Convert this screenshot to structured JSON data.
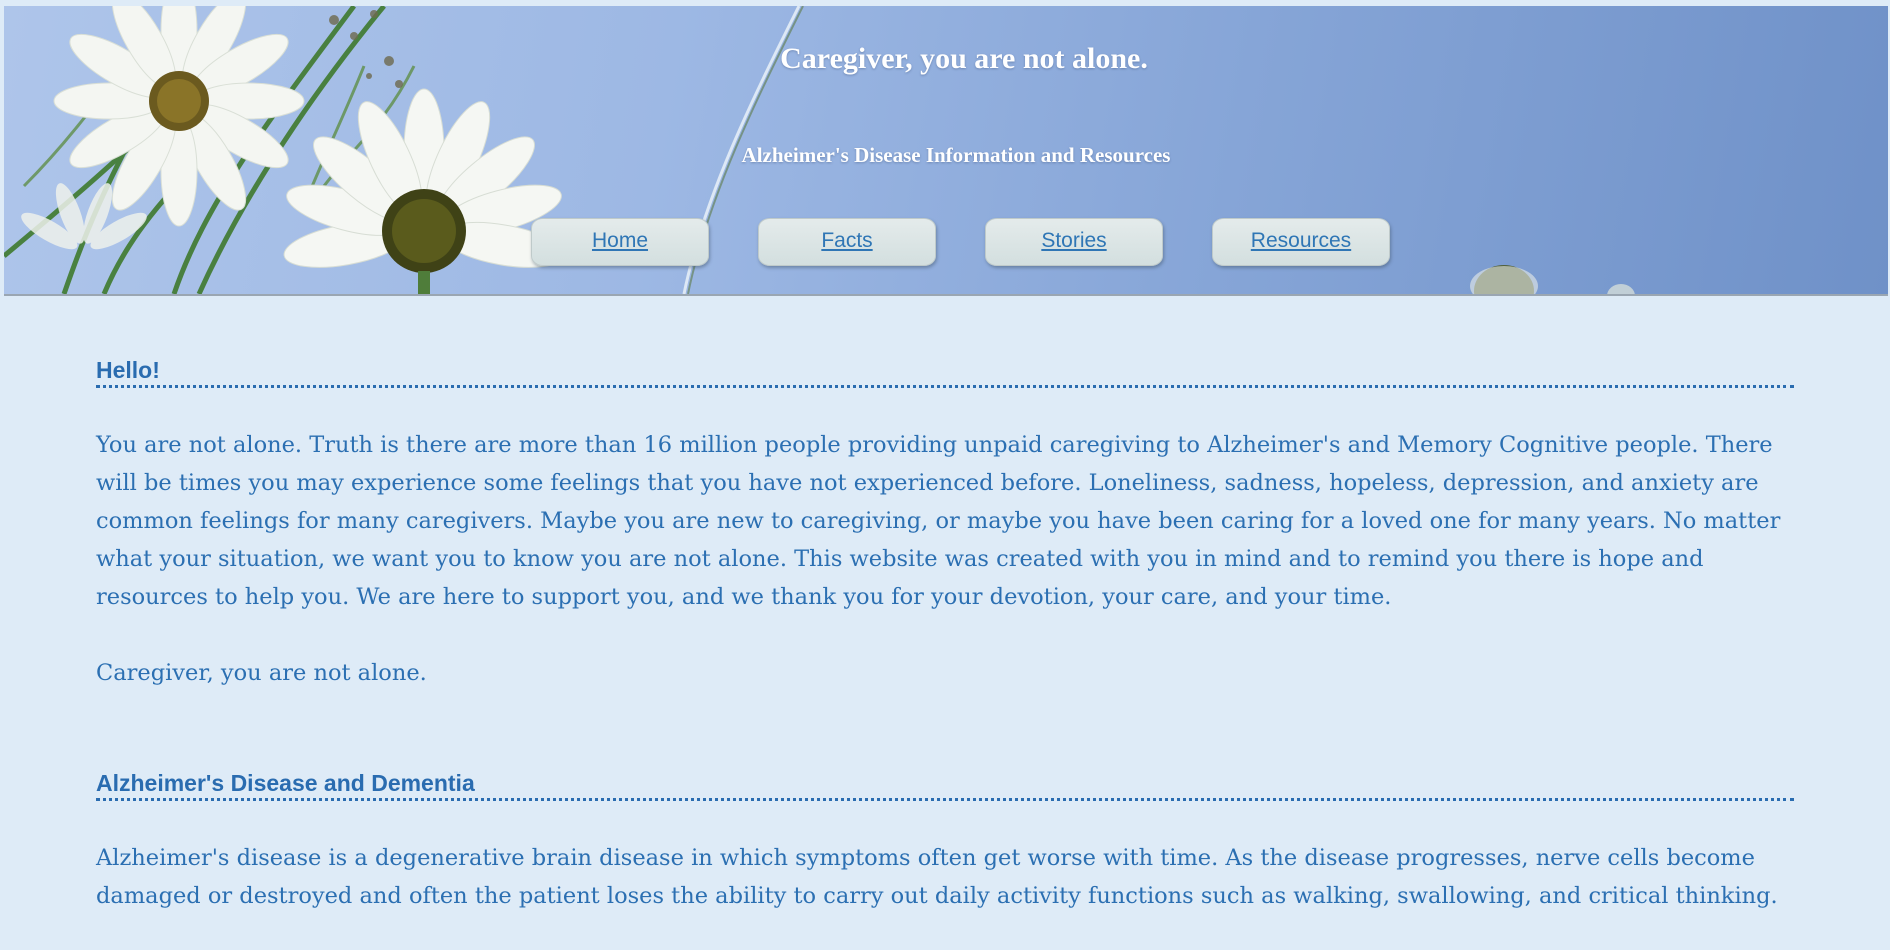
{
  "header": {
    "title": "Caregiver, you are not alone.",
    "subtitle": "Alzheimer's Disease Information and Resources"
  },
  "nav": {
    "items": [
      {
        "label": "Home"
      },
      {
        "label": "Facts"
      },
      {
        "label": "Stories"
      },
      {
        "label": "Resources"
      }
    ]
  },
  "sections": [
    {
      "heading": "Hello!",
      "paragraphs": [
        "You are not alone. Truth is there are more than 16 million people providing unpaid caregiving to Alzheimer's and Memory Cognitive people. There will be times you may experience some feelings that you have not experienced before. Loneliness, sadness, hopeless, depression, and anxiety are common feelings for many caregivers. Maybe you are new to caregiving, or maybe you have been caring for a loved one for many years. No matter what your situation, we want you to know you are not alone. This website was created with you in mind and to remind you there is hope and resources to help you. We are here to support you, and we thank you for your devotion, your care, and your time.",
        "Caregiver, you are not alone."
      ]
    },
    {
      "heading": "Alzheimer's Disease and Dementia",
      "paragraphs": [
        "Alzheimer's disease is a degenerative brain disease in which symptoms often get worse with time. As the disease progresses, nerve cells become damaged or destroyed and often the patient loses the ability to carry out daily activity functions such as walking, swallowing, and critical thinking."
      ]
    }
  ],
  "colors": {
    "page_background": "#deebf7",
    "text": "#2b6fb2",
    "heading": "#2a6cb0",
    "nav_button": "#d8e3e3",
    "sky_light": "#aec5ea",
    "sky_dark": "#6f91c8"
  }
}
